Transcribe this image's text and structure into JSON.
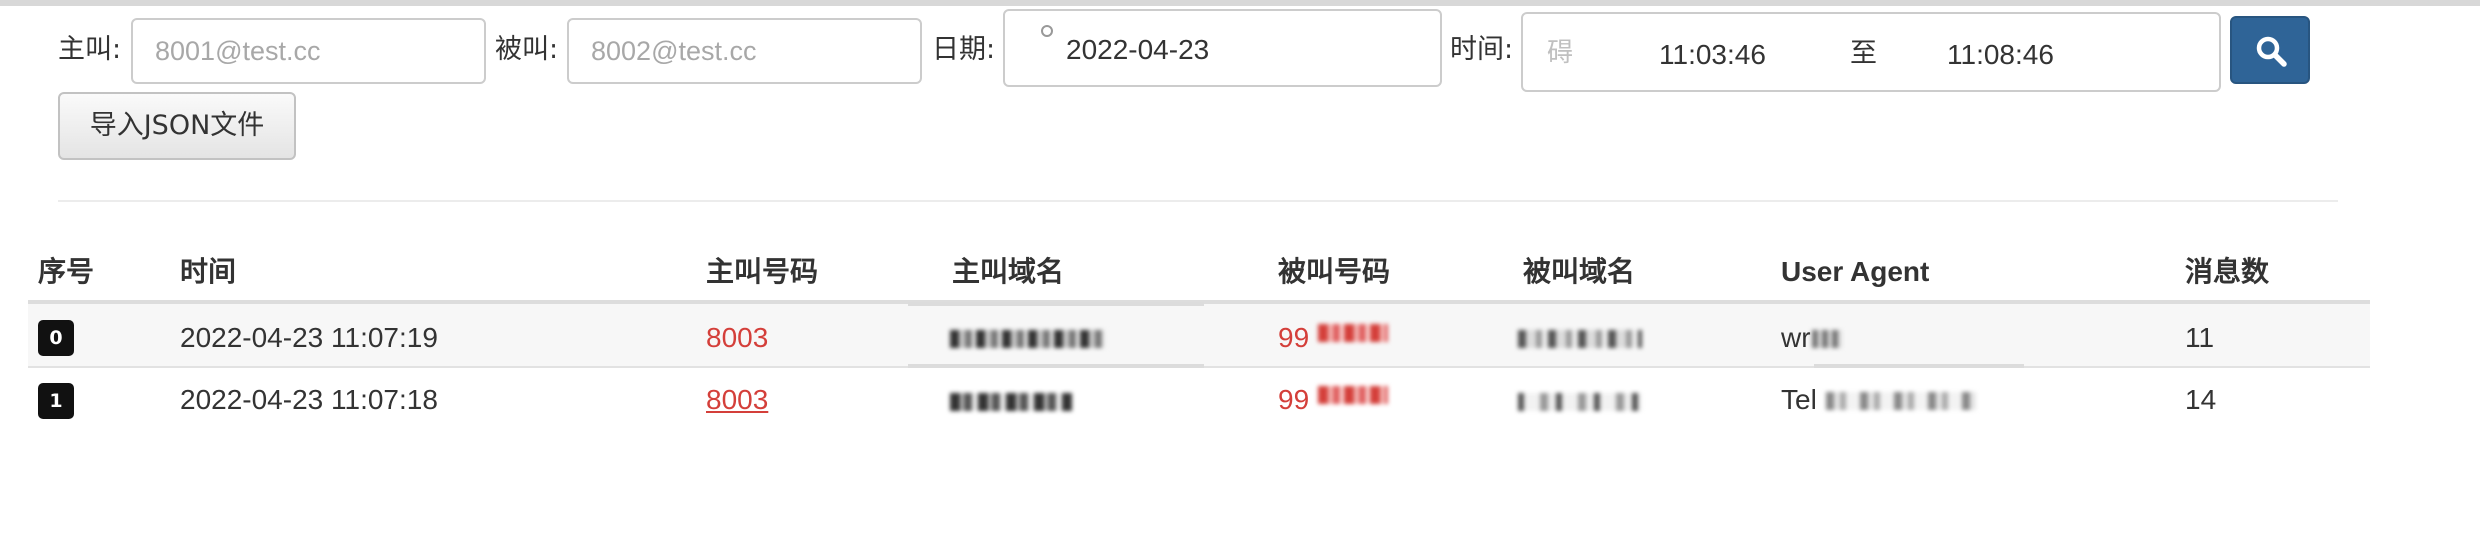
{
  "filters": {
    "caller_label": "主叫:",
    "caller_placeholder": "8001@test.cc",
    "callee_label": "被叫:",
    "callee_placeholder": "8002@test.cc",
    "date_label": "日期:",
    "date_value": "2022-04-23",
    "time_label": "时间:",
    "time_icon_glyph": "碍",
    "time_start": "11:03:46",
    "time_sep": "至",
    "time_end": "11:08:46",
    "search_icon": "search-icon",
    "import_label": "导入JSON文件"
  },
  "table": {
    "headers": [
      "序号",
      "时间",
      "主叫号码",
      "主叫域名",
      "被叫号码",
      "被叫域名",
      "User Agent",
      "消息数"
    ],
    "rows": [
      {
        "index": "0",
        "time": "2022-04-23 11:07:19",
        "caller_number": "8003",
        "caller_domain": "",
        "callee_number": "99",
        "callee_domain": "",
        "user_agent": "wr",
        "messages": "11"
      },
      {
        "index": "1",
        "time": "2022-04-23 11:07:18",
        "caller_number": "8003",
        "caller_domain": "",
        "callee_number": "99",
        "callee_domain": "",
        "user_agent": "Tel",
        "messages": "14"
      }
    ]
  },
  "colors": {
    "accent_button": "#2f6497",
    "number_red": "#d43f3a"
  }
}
